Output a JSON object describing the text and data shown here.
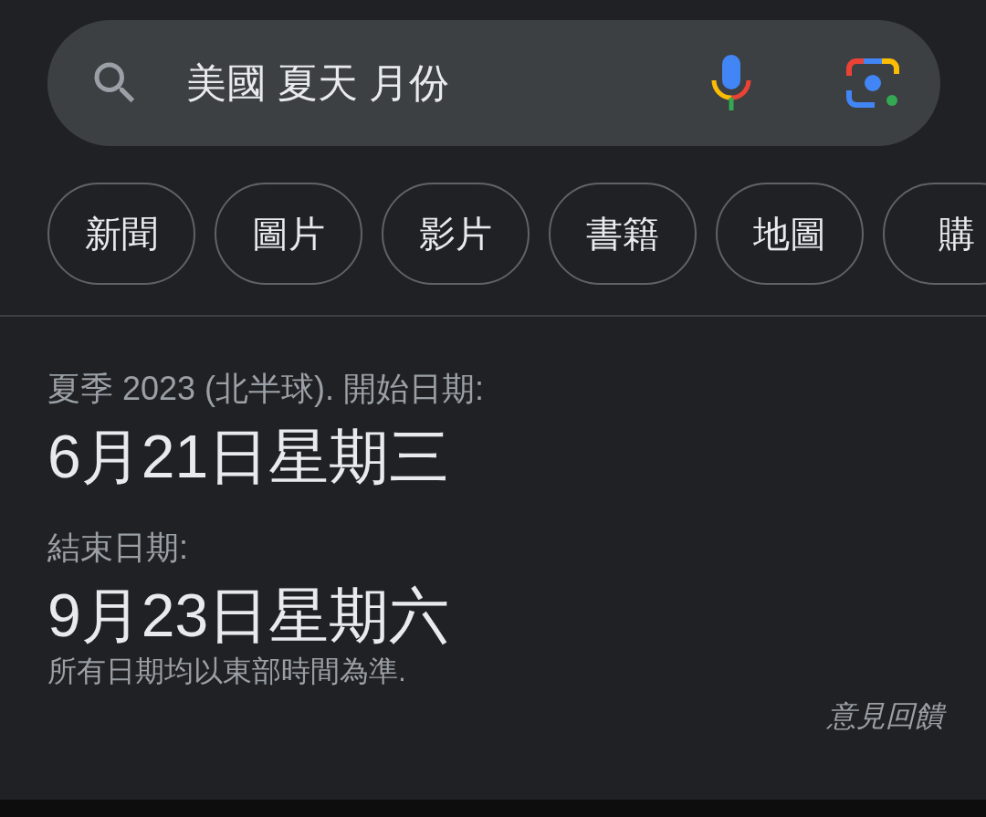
{
  "search": {
    "value": "美國 夏天 月份"
  },
  "chips": [
    {
      "label": "新聞"
    },
    {
      "label": "圖片"
    },
    {
      "label": "影片"
    },
    {
      "label": "書籍"
    },
    {
      "label": "地圖"
    },
    {
      "label": "購"
    }
  ],
  "answer": {
    "caption": "夏季 2023 (北半球). 開始日期:",
    "start": "6月21日星期三",
    "end_caption": "結束日期:",
    "end": "9月23日星期六",
    "note": "所有日期均以東部時間為準.",
    "feedback": "意見回饋"
  }
}
